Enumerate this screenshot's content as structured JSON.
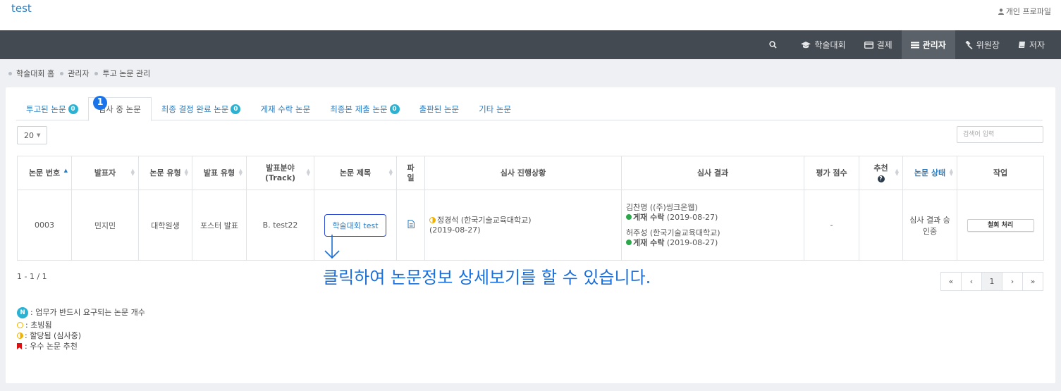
{
  "brand": "test",
  "profile_label": "개인 프로파일",
  "nav": {
    "items": [
      {
        "label": "학술대회",
        "icon": "graduation-cap-icon"
      },
      {
        "label": "결제",
        "icon": "credit-card-icon"
      },
      {
        "label": "관리자",
        "icon": "list-icon"
      },
      {
        "label": "위원장",
        "icon": "gavel-icon"
      },
      {
        "label": "저자",
        "icon": "book-icon"
      }
    ],
    "active": "관리자"
  },
  "breadcrumb": [
    "학술대회 홈",
    "관리자",
    "투고 논문 관리"
  ],
  "tabs": [
    {
      "label": "투고된 논문",
      "badge": "0"
    },
    {
      "label": "심사 중 논문"
    },
    {
      "label": "최종 결정 완료 논문",
      "badge": "0"
    },
    {
      "label": "게재 수락 논문"
    },
    {
      "label": "최종본 제출 논문",
      "badge": "0"
    },
    {
      "label": "출판된 논문"
    },
    {
      "label": "기타 논문"
    }
  ],
  "step_marker": "1",
  "page_size": "20",
  "search": {
    "placeholder": "검색어 입력"
  },
  "table": {
    "headers": [
      "논문 번호",
      "발표자",
      "논문 유형",
      "발표 유형",
      "발표분야 (Track)",
      "논문 제목",
      "파일",
      "심사 진행상황",
      "심사 결과",
      "평가 점수",
      "추천",
      "논문 상태",
      "작업"
    ],
    "row": {
      "number": "0003",
      "presenter": "민지민",
      "paper_type": "대학원생",
      "presentation_type": "포스터 발표",
      "track": "B. test22",
      "title": "학술대회 test",
      "progress_reviewer": "정경석 (한국기술교육대학교)",
      "progress_date": "(2019-08-27)",
      "result1_reviewer": "김찬명 ((주)씽크온웹)",
      "result1_status": "게재 수락",
      "result1_date": "(2019-08-27)",
      "result2_reviewer": "허주성 (한국기술교육대학교)",
      "result2_status": "게재 수락",
      "result2_date": "(2019-08-27)",
      "score": "-",
      "status": "심사 결과 승인중",
      "action": "철회 처리"
    }
  },
  "annotation": "클릭하여 논문정보 상세보기를 할 수 있습니다.",
  "range": "1 - 1 / 1",
  "pager": [
    "«",
    "‹",
    "1",
    "›",
    "»"
  ],
  "legend": {
    "n_badge": "N",
    "n_text": ": 업무가 반드시 요구되는 논문 개수",
    "invited": ": 초빙됨",
    "assigned": ": 할당됨 (심사중)",
    "recommended": ": 우수 논문 추천"
  },
  "colors": {
    "accent": "#2b7cc0",
    "navbar": "#444a51",
    "badge": "#2bb1d1",
    "annotation": "#1a6fd9",
    "accepted": "#2aa84a"
  }
}
